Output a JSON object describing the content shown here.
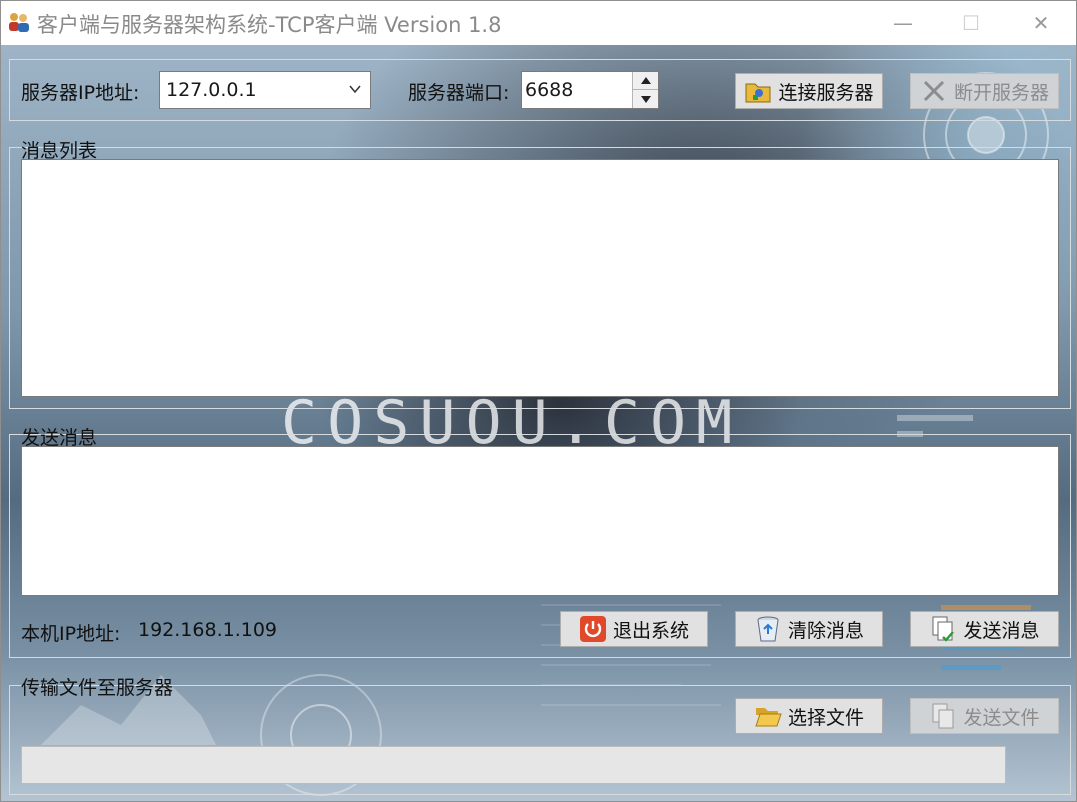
{
  "window": {
    "title": "客户端与服务器架构系统-TCP客户端 Version 1.8",
    "minimize_glyph": "—",
    "maximize_glyph": "☐",
    "close_glyph": "✕"
  },
  "connection": {
    "ip_label": "服务器IP地址:",
    "ip_value": "127.0.0.1",
    "port_label": "服务器端口:",
    "port_value": "6688",
    "connect_label": "连接服务器",
    "disconnect_label": "断开服务器"
  },
  "message_list": {
    "group_label": "消息列表"
  },
  "send_message": {
    "group_label": "发送消息",
    "local_ip_label": "本机IP地址:",
    "local_ip_value": "192.168.1.109",
    "exit_label": "退出系统",
    "clear_label": "清除消息",
    "send_label": "发送消息"
  },
  "file_transfer": {
    "group_label": "传输文件至服务器",
    "choose_label": "选择文件",
    "send_file_label": "发送文件",
    "progress_fraction": 0
  },
  "background_text": "COSUOU.COM",
  "icons": {
    "app": "users-icon",
    "connect": "folder-connect-icon",
    "disconnect": "x-icon",
    "exit": "power-icon",
    "clear": "recycle-bin-icon",
    "send": "document-send-icon",
    "choose": "open-folder-icon",
    "send_file": "document-copy-icon"
  },
  "colors": {
    "accent_red": "#e04a2a",
    "disabled_text": "#8c8c8c"
  }
}
